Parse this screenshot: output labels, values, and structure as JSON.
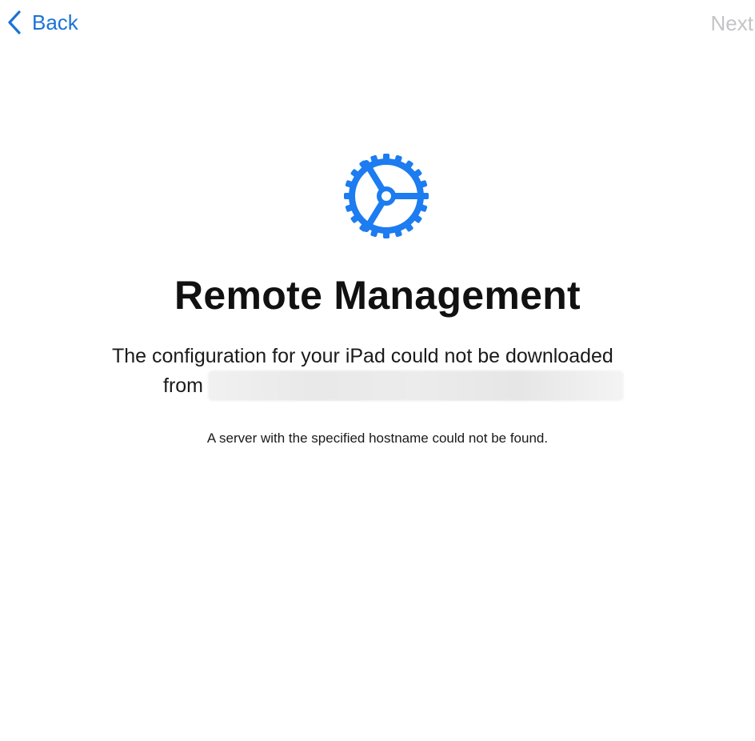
{
  "nav": {
    "back_label": "Back",
    "next_label": "Next"
  },
  "icons": {
    "back": "chevron-left-icon",
    "main": "gear-icon"
  },
  "content": {
    "title": "Remote Management",
    "message_line1": "The configuration for your iPad could not be downloaded",
    "message_line2_prefix": "from",
    "error_text": "A server with the specified hostname could not be found."
  },
  "colors": {
    "accent": "#1a73d6",
    "icon": "#1c7cf0",
    "disabled": "#c4c4c7",
    "text": "#111111"
  }
}
